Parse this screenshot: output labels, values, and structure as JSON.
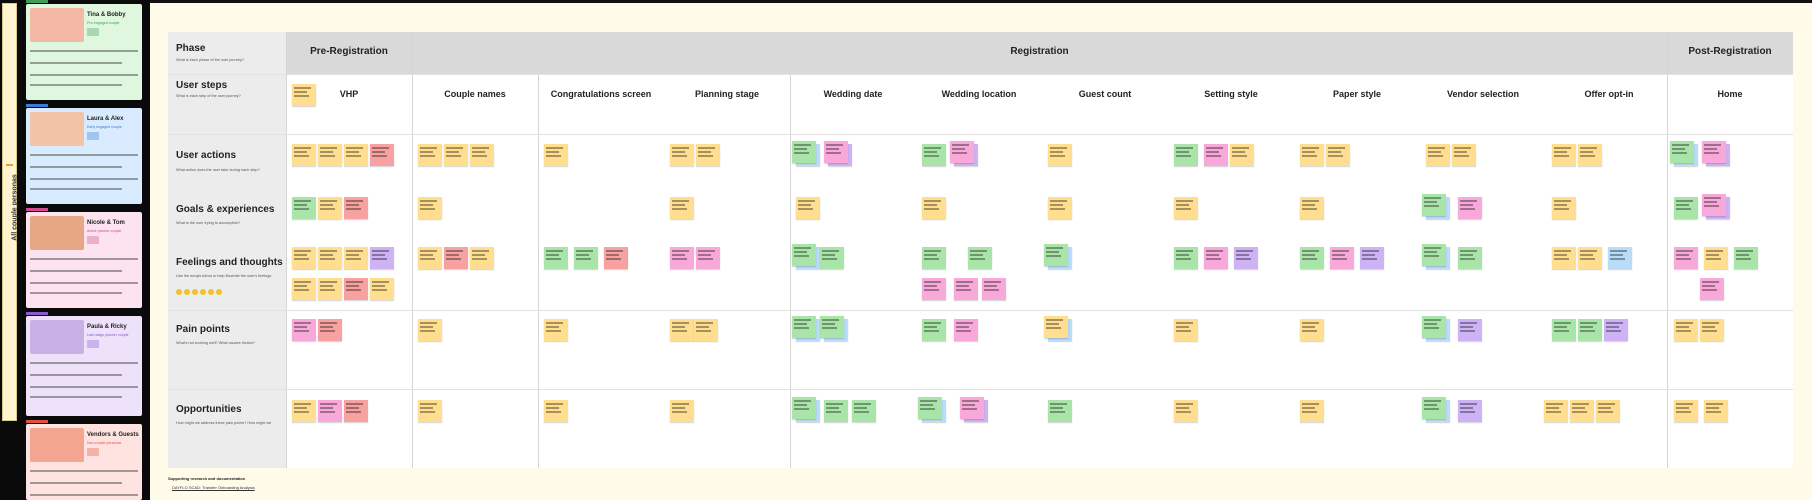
{
  "sidebar": {
    "tab_label": "All couple personas",
    "personas": [
      {
        "name": "Tina & Bobby",
        "subtitle": "Pre-engaged couple",
        "color": "#dff7de",
        "tag": "#3f9e55",
        "sub_color": "#3f9e55",
        "img": "#f4b8a6"
      },
      {
        "name": "Laura & Alex",
        "subtitle": "Early engaged couple",
        "color": "#d9ecff",
        "tag": "#3a7bd5",
        "sub_color": "#3a7bd5",
        "img": "#f2c3a4"
      },
      {
        "name": "Nicole & Tom",
        "subtitle": "Active planner couple",
        "color": "#fde2ef",
        "tag": "#d24c8f",
        "sub_color": "#d24c8f",
        "img": "#e6a784"
      },
      {
        "name": "Paula & Ricky",
        "subtitle": "Late-stage planner couple",
        "color": "#eee2fb",
        "tag": "#8a5ad1",
        "sub_color": "#8a5ad1",
        "img": "#c9b1e6"
      },
      {
        "name": "Vendors & Guests",
        "subtitle": "Non-couple personas",
        "color": "#ffe3e0",
        "tag": "#e0523f",
        "sub_color": "#e0523f",
        "img": "#f3a58f"
      }
    ]
  },
  "board": {
    "row_labels": [
      {
        "title": "Phase",
        "sub": "What is each phase of the user journey?"
      },
      {
        "title": "User steps",
        "sub": "What is each step of the user journey?"
      },
      {
        "title": "User actions",
        "sub": "What action does the user take during each step?"
      },
      {
        "title": "Goals & experiences",
        "sub": "What is the user trying to accomplish?"
      },
      {
        "title": "Feelings and thoughts",
        "sub": "Use the emojis below to help illustrate the user's feelings"
      },
      {
        "title": "Pain points",
        "sub": "What's not working well? What causes friction?"
      },
      {
        "title": "Opportunities",
        "sub": "How might we address these pain points? How might we"
      }
    ],
    "phases": [
      "Pre-Registration",
      "Registration",
      "Post-Registration"
    ],
    "steps": [
      "VHP",
      "Couple names",
      "Congratulations screen",
      "Planning stage",
      "Wedding date",
      "Wedding location",
      "Guest count",
      "Setting style",
      "Paper style",
      "Vendor selection",
      "Offer opt-in",
      "Home"
    ],
    "emoji_color": "#f2c230"
  },
  "footer": {
    "heading": "Supporting research and documentation",
    "link": "DAYFLO SCAD: Transfer Onboarding Analysis"
  },
  "colors": {
    "yellow": "#ffdf8f",
    "green": "#a9e5a9",
    "pink": "#f8a8d9",
    "red": "#f7a1a1",
    "purple": "#cdb3f5",
    "blue": "#b9dcf8"
  }
}
